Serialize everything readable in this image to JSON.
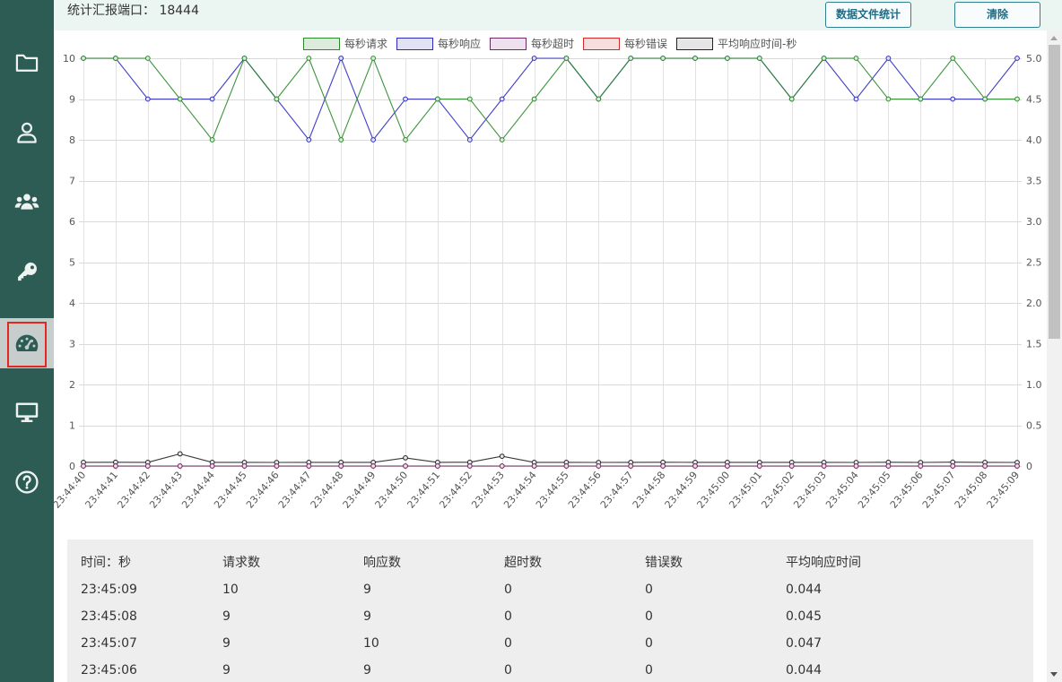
{
  "header": {
    "port_text": "统计汇报端口： 18444",
    "stats_button": "数据文件统计",
    "clear_button": "清除"
  },
  "sidebar": {
    "items": [
      {
        "icon": "folder-icon"
      },
      {
        "icon": "user-icon"
      },
      {
        "icon": "users-icon"
      },
      {
        "icon": "key-icon"
      },
      {
        "icon": "dashboard-icon",
        "active": true
      },
      {
        "icon": "desktop-icon"
      },
      {
        "icon": "question-circle-icon"
      }
    ]
  },
  "colors": {
    "sidebar_bg": "#2d5c54",
    "active_item_bg": "#c6cdcc",
    "active_outline": "#e3261f",
    "button_text": "#1f6c84",
    "table_bg": "#eeeeee"
  },
  "chart_data": {
    "type": "line",
    "x": [
      "23:44:40",
      "23:44:41",
      "23:44:42",
      "23:44:43",
      "23:44:44",
      "23:44:45",
      "23:44:46",
      "23:44:47",
      "23:44:48",
      "23:44:49",
      "23:44:50",
      "23:44:51",
      "23:44:52",
      "23:44:53",
      "23:44:54",
      "23:44:55",
      "23:44:56",
      "23:44:57",
      "23:44:58",
      "23:44:59",
      "23:45:00",
      "23:45:01",
      "23:45:02",
      "23:45:03",
      "23:45:04",
      "23:45:05",
      "23:45:06",
      "23:45:07",
      "23:45:08",
      "23:45:09"
    ],
    "y_left": {
      "min": 0,
      "max": 10,
      "ticks": [
        "0",
        "1",
        "2",
        "3",
        "4",
        "5",
        "6",
        "7",
        "8",
        "9",
        "10"
      ]
    },
    "y_right": {
      "min": 0,
      "max": 5,
      "ticks": [
        "0",
        "0.5",
        "1.0",
        "1.5",
        "2.0",
        "2.5",
        "3.0",
        "3.5",
        "4.0",
        "4.5",
        "5.0"
      ]
    },
    "grid": true,
    "legend": "top",
    "series": [
      {
        "name": "每秒请求",
        "axis": "left",
        "color": "#2a8a2a",
        "fill": "#dcebdc",
        "values": [
          10,
          10,
          10,
          9,
          8,
          10,
          9,
          10,
          8,
          10,
          8,
          9,
          9,
          8,
          9,
          10,
          9,
          10,
          10,
          10,
          10,
          10,
          9,
          10,
          10,
          9,
          9,
          10,
          9,
          9
        ]
      },
      {
        "name": "每秒响应",
        "axis": "left",
        "color": "#2b2bc0",
        "fill": "#e2e2f5",
        "values": [
          10,
          10,
          9,
          9,
          9,
          10,
          9,
          8,
          10,
          8,
          9,
          9,
          8,
          9,
          10,
          10,
          9,
          10,
          10,
          10,
          10,
          10,
          9,
          10,
          9,
          10,
          9,
          9,
          9,
          10
        ]
      },
      {
        "name": "每秒超时",
        "axis": "left",
        "color": "#6e2a66",
        "fill": "#eee0ec",
        "values": [
          0,
          0,
          0,
          0,
          0,
          0,
          0,
          0,
          0,
          0,
          0,
          0,
          0,
          0,
          0,
          0,
          0,
          0,
          0,
          0,
          0,
          0,
          0,
          0,
          0,
          0,
          0,
          0,
          0,
          0
        ]
      },
      {
        "name": "每秒错误",
        "axis": "left",
        "color": "#d22a2a",
        "fill": "#f7dede",
        "values": [
          0,
          0,
          0,
          0,
          0,
          0,
          0,
          0,
          0,
          0,
          0,
          0,
          0,
          0,
          0,
          0,
          0,
          0,
          0,
          0,
          0,
          0,
          0,
          0,
          0,
          0,
          0,
          0,
          0,
          0
        ]
      },
      {
        "name": "平均响应时间-秒",
        "axis": "right",
        "color": "#222222",
        "fill": "#e6e6e6",
        "values": [
          0.045,
          0.046,
          0.045,
          0.15,
          0.045,
          0.045,
          0.044,
          0.045,
          0.045,
          0.045,
          0.1,
          0.045,
          0.046,
          0.12,
          0.045,
          0.045,
          0.044,
          0.045,
          0.046,
          0.045,
          0.045,
          0.045,
          0.045,
          0.045,
          0.044,
          0.046,
          0.044,
          0.047,
          0.045,
          0.044
        ]
      }
    ]
  },
  "table": {
    "headers": [
      "时间：秒",
      "请求数",
      "响应数",
      "超时数",
      "错误数",
      "平均响应时间"
    ],
    "rows": [
      [
        "23:45:09",
        "10",
        "9",
        "0",
        "0",
        "0.044"
      ],
      [
        "23:45:08",
        "9",
        "9",
        "0",
        "0",
        "0.045"
      ],
      [
        "23:45:07",
        "9",
        "10",
        "0",
        "0",
        "0.047"
      ],
      [
        "23:45:06",
        "9",
        "9",
        "0",
        "0",
        "0.044"
      ]
    ]
  }
}
